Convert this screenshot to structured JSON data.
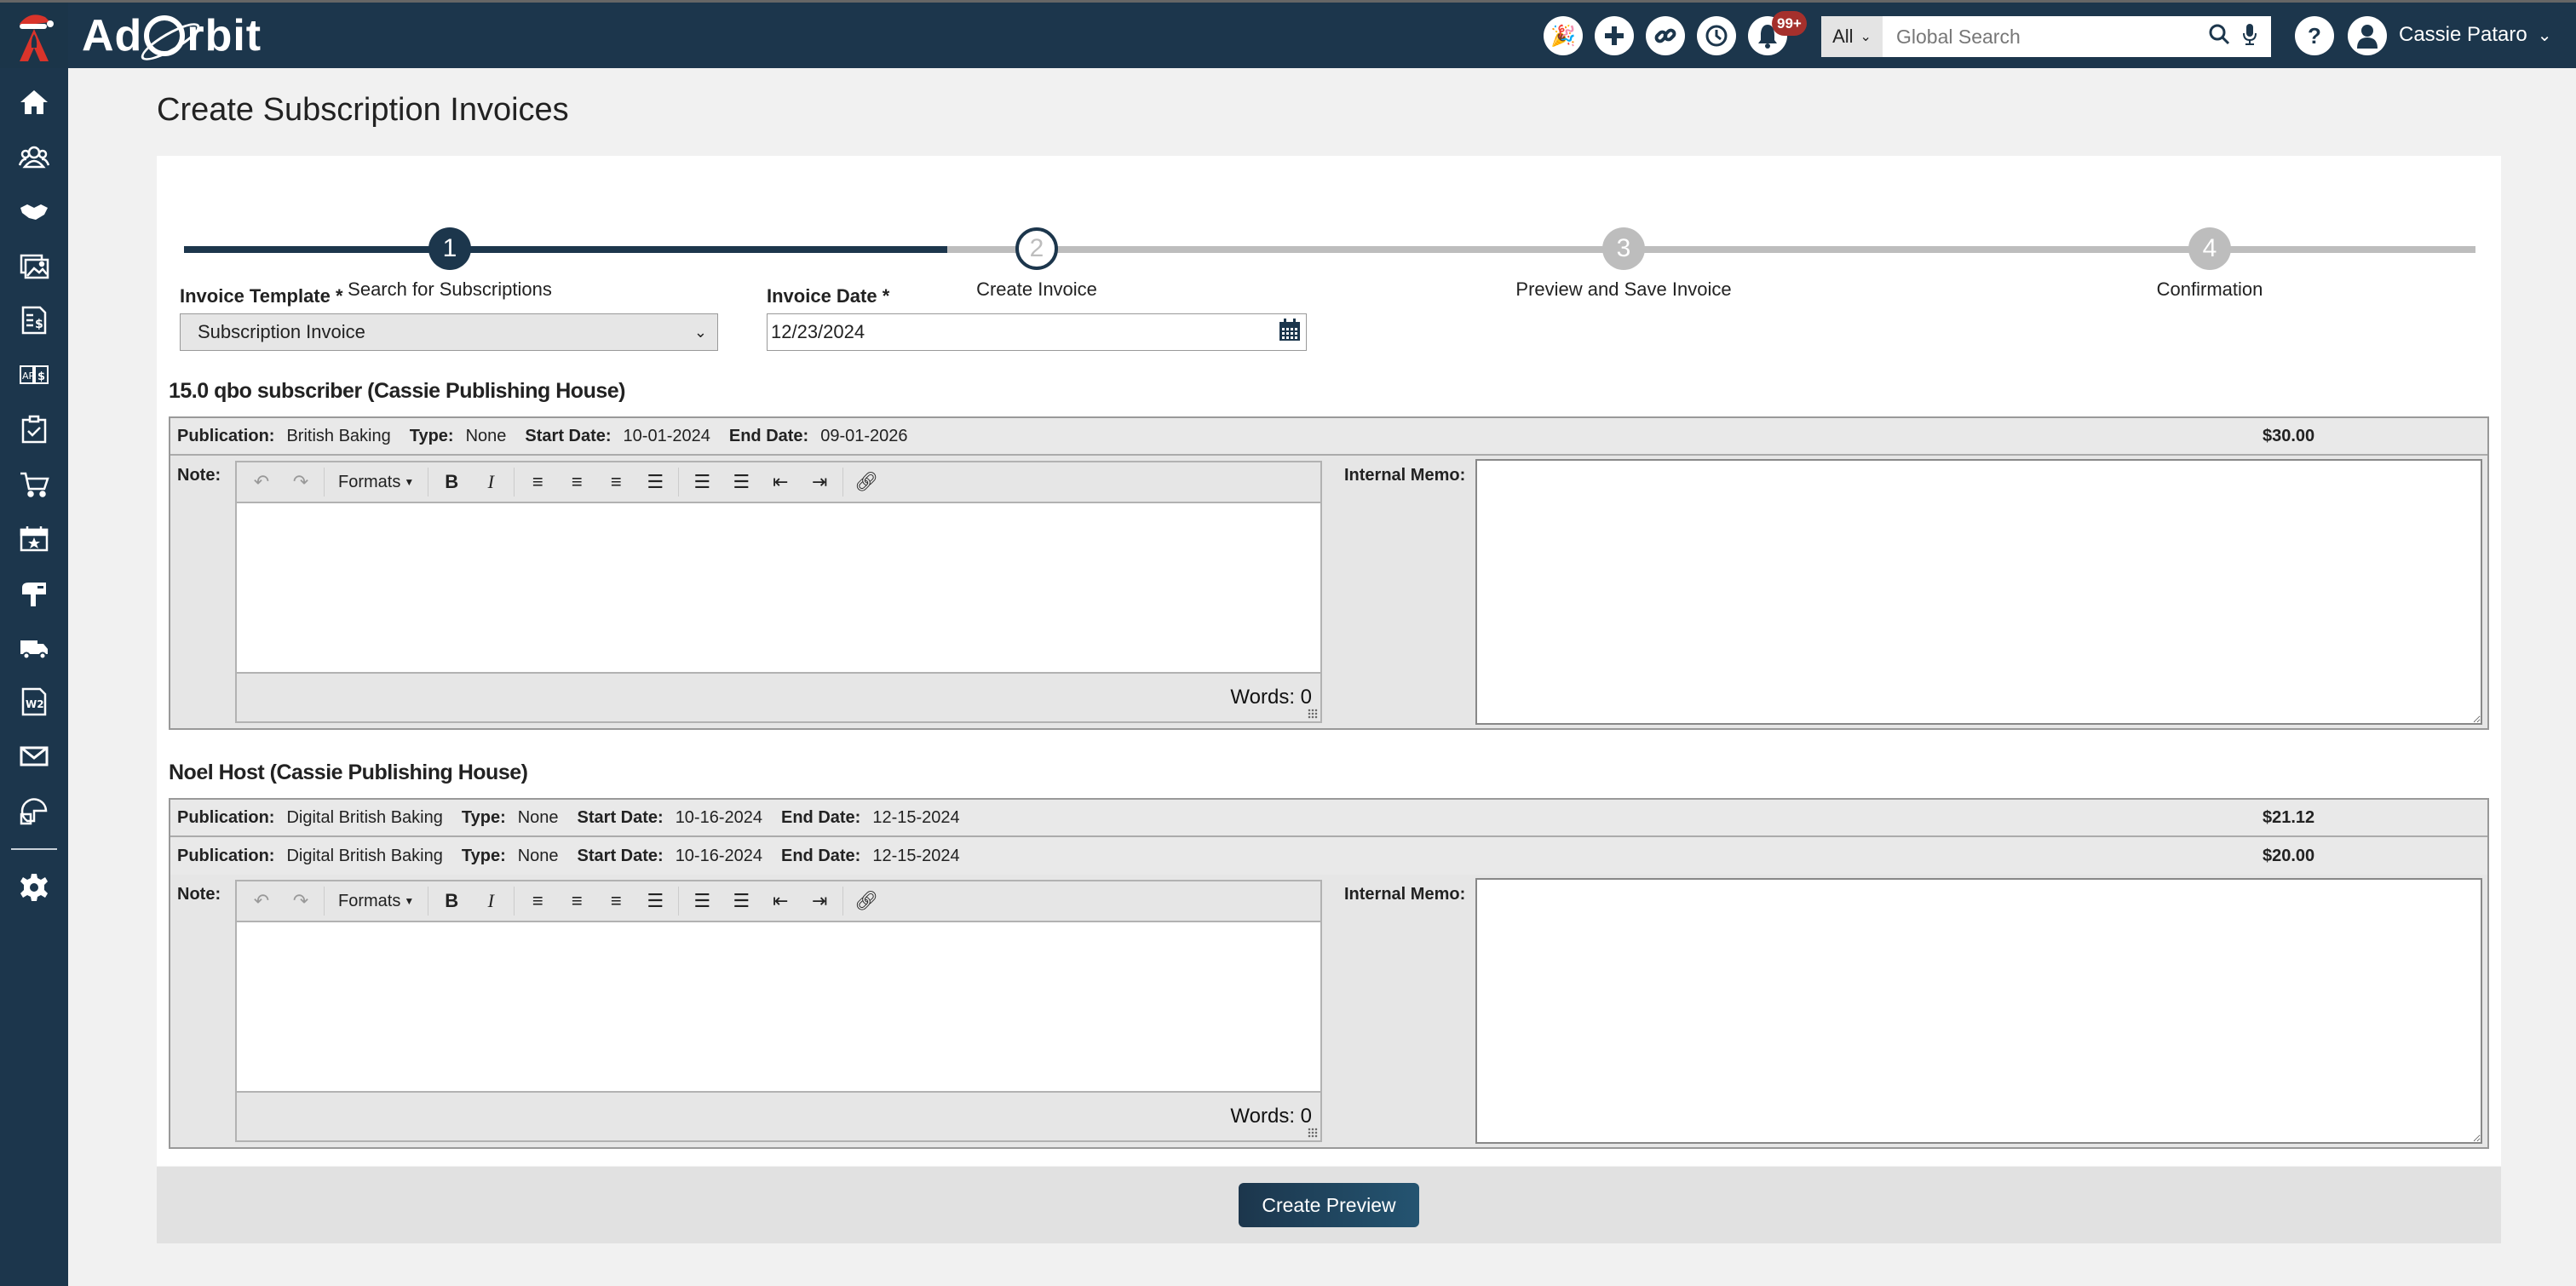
{
  "app": {
    "brand": "AdOrbit",
    "brand_prefix": "Ad",
    "brand_suffix": "rbit",
    "colors": {
      "primary": "#1c364c",
      "badge": "#a5302c",
      "logo_accent": "#d9342b",
      "inactive_step": "#bdbdbd"
    }
  },
  "topbar": {
    "icons": [
      "celebration-icon",
      "add-icon",
      "link-icon",
      "history-icon",
      "notifications-icon"
    ],
    "notification_badge": "99+",
    "search": {
      "scope": "All",
      "placeholder": "Global Search",
      "value": ""
    },
    "help_icon": "help-icon",
    "user_name": "Cassie Pataro"
  },
  "sidebar": {
    "items": [
      {
        "icon": "home-icon",
        "label": "Home"
      },
      {
        "icon": "contacts-icon",
        "label": "Contacts"
      },
      {
        "icon": "handshake-icon",
        "label": "CRM"
      },
      {
        "icon": "media-icon",
        "label": "Media"
      },
      {
        "icon": "invoice-icon",
        "label": "Billing"
      },
      {
        "icon": "ap-ar-icon",
        "label": "Accounting"
      },
      {
        "icon": "clipboard-check-icon",
        "label": "Tasks"
      },
      {
        "icon": "cart-icon",
        "label": "Orders"
      },
      {
        "icon": "calendar-star-icon",
        "label": "Events"
      },
      {
        "icon": "mailbox-icon",
        "label": "Subscriptions"
      },
      {
        "icon": "truck-icon",
        "label": "Distribution"
      },
      {
        "icon": "w2-icon",
        "label": "Payroll"
      },
      {
        "icon": "mail-icon",
        "label": "Email"
      },
      {
        "icon": "reports-icon",
        "label": "Reports"
      }
    ],
    "settings_icon": "gear-icon"
  },
  "page": {
    "title": "Create Subscription Invoices",
    "progress_fraction": 0.333,
    "steps": [
      {
        "number": "1",
        "label": "Search for Subscriptions",
        "state": "complete"
      },
      {
        "number": "2",
        "label": "Create Invoice",
        "state": "current"
      },
      {
        "number": "3",
        "label": "Preview and Save Invoice",
        "state": "upcoming"
      },
      {
        "number": "4",
        "label": "Confirmation",
        "state": "upcoming"
      }
    ],
    "invoice_template": {
      "label": "Invoice Template *",
      "value": "Subscription Invoice"
    },
    "invoice_date": {
      "label": "Invoice Date *",
      "value": "12/23/2024"
    },
    "labels": {
      "publication": "Publication:",
      "type": "Type:",
      "start_date": "Start Date:",
      "end_date": "End Date:",
      "note": "Note:",
      "internal_memo": "Internal Memo:",
      "formats": "Formats",
      "words_prefix": "Words: "
    },
    "subscribers": [
      {
        "title": "15.0 qbo subscriber (Cassie Publishing House)",
        "subscriptions": [
          {
            "publication": "British Baking",
            "type": "None",
            "start_date": "10-01-2024",
            "end_date": "09-01-2026",
            "price": "$30.00"
          }
        ],
        "words": "Words: 0",
        "note": "",
        "memo": ""
      },
      {
        "title": "Noel Host (Cassie Publishing House)",
        "subscriptions": [
          {
            "publication": "Digital British Baking",
            "type": "None",
            "start_date": "10-16-2024",
            "end_date": "12-15-2024",
            "price": "$21.12"
          },
          {
            "publication": "Digital British Baking",
            "type": "None",
            "start_date": "10-16-2024",
            "end_date": "12-15-2024",
            "price": "$20.00"
          }
        ],
        "words": "Words: 0",
        "note": "",
        "memo": ""
      }
    ],
    "create_preview_label": "Create Preview"
  }
}
